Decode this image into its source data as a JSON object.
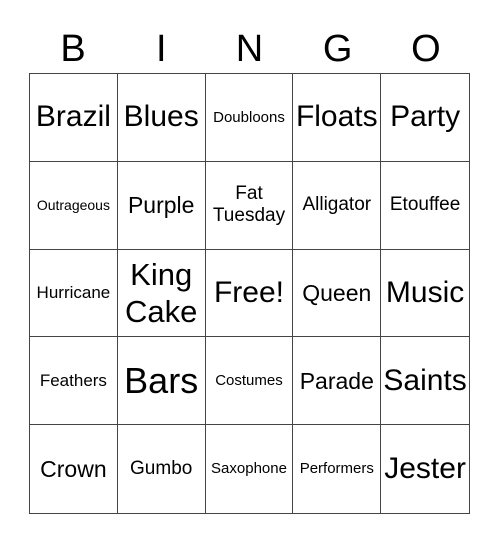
{
  "header": {
    "letters": [
      "B",
      "I",
      "N",
      "G",
      "O"
    ]
  },
  "card": {
    "rows": [
      [
        "Brazil",
        "Blues",
        "Doubloons",
        "Floats",
        "Party"
      ],
      [
        "Outrageous",
        "Purple",
        "Fat\nTuesday",
        "Alligator",
        "Etouffee"
      ],
      [
        "Hurricane",
        "King\nCake",
        "Free!",
        "Queen",
        "Music"
      ],
      [
        "Feathers",
        "Bars",
        "Costumes",
        "Parade",
        "Saints"
      ],
      [
        "Crown",
        "Gumbo",
        "Saxophone",
        "Performers",
        "Jester"
      ]
    ],
    "free_space": "Free!"
  }
}
